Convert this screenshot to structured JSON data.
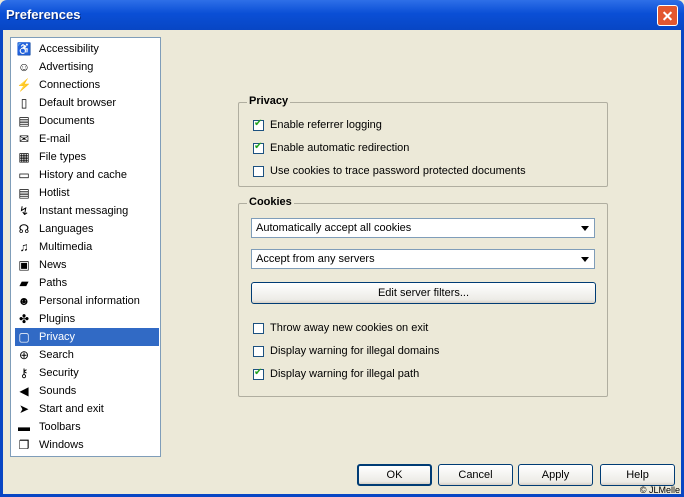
{
  "window": {
    "title": "Preferences"
  },
  "sidebar": {
    "items": [
      {
        "label": "Accessibility",
        "icon": "wheelchair-icon",
        "glyph": "♿"
      },
      {
        "label": "Advertising",
        "icon": "smiley-icon",
        "glyph": "☺"
      },
      {
        "label": "Connections",
        "icon": "plug-icon",
        "glyph": "⚡"
      },
      {
        "label": "Default browser",
        "icon": "document-icon",
        "glyph": "▯"
      },
      {
        "label": "Documents",
        "icon": "documents-icon",
        "glyph": "▤"
      },
      {
        "label": "E-mail",
        "icon": "envelope-icon",
        "glyph": "✉"
      },
      {
        "label": "File types",
        "icon": "file-types-icon",
        "glyph": "▦"
      },
      {
        "label": "History and cache",
        "icon": "cache-icon",
        "glyph": "▭"
      },
      {
        "label": "Hotlist",
        "icon": "hotlist-icon",
        "glyph": "▤"
      },
      {
        "label": "Instant messaging",
        "icon": "lightning-icon",
        "glyph": "↯"
      },
      {
        "label": "Languages",
        "icon": "speech-icon",
        "glyph": "☊"
      },
      {
        "label": "Multimedia",
        "icon": "multimedia-icon",
        "glyph": "♫"
      },
      {
        "label": "News",
        "icon": "newspaper-icon",
        "glyph": "▣"
      },
      {
        "label": "Paths",
        "icon": "folder-icon",
        "glyph": "▰"
      },
      {
        "label": "Personal information",
        "icon": "person-icon",
        "glyph": "☻"
      },
      {
        "label": "Plugins",
        "icon": "puzzle-icon",
        "glyph": "✤"
      },
      {
        "label": "Privacy",
        "icon": "privacy-icon",
        "glyph": "▢"
      },
      {
        "label": "Search",
        "icon": "search-icon",
        "glyph": "⊕"
      },
      {
        "label": "Security",
        "icon": "keys-icon",
        "glyph": "⚷"
      },
      {
        "label": "Sounds",
        "icon": "speaker-icon",
        "glyph": "◀"
      },
      {
        "label": "Start and exit",
        "icon": "start-icon",
        "glyph": "➤"
      },
      {
        "label": "Toolbars",
        "icon": "toolbar-icon",
        "glyph": "▬"
      },
      {
        "label": "Windows",
        "icon": "windows-icon",
        "glyph": "❐"
      }
    ],
    "selected_index": 16
  },
  "privacy": {
    "legend": "Privacy",
    "options": [
      {
        "label": "Enable referrer logging",
        "checked": true
      },
      {
        "label": "Enable automatic redirection",
        "checked": true
      },
      {
        "label": "Use cookies to trace password protected documents",
        "checked": false
      }
    ]
  },
  "cookies": {
    "legend": "Cookies",
    "accept_select": "Automatically accept all cookies",
    "server_select": "Accept from any servers",
    "edit_filters": "Edit server filters...",
    "options": [
      {
        "label": "Throw away new cookies on exit",
        "checked": false
      },
      {
        "label": "Display warning for illegal domains",
        "checked": false
      },
      {
        "label": "Display warning for illegal path",
        "checked": true
      }
    ]
  },
  "buttons": {
    "ok": "OK",
    "cancel": "Cancel",
    "apply": "Apply",
    "help": "Help"
  },
  "watermark": "© JLMelle"
}
